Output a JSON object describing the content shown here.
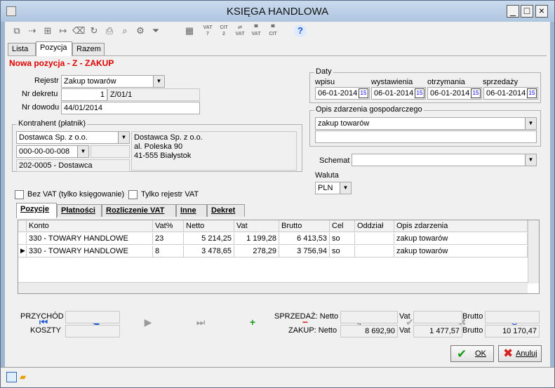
{
  "window": {
    "title": "KSIĘGA HANDLOWA",
    "minimize": "_",
    "maximize": "□",
    "close": "×"
  },
  "toolbar": {
    "icons": [
      "copy-icon",
      "insert-icon",
      "duplicate-icon",
      "move-icon",
      "delete-icon",
      "refresh-icon",
      "print-icon",
      "search-icon",
      "tools-icon",
      "filter-icon"
    ],
    "vat_labels": [
      "VAT\n?",
      "CIT\n?",
      "VAT",
      "VAT",
      "CIT"
    ],
    "help": "?"
  },
  "tabs": [
    {
      "label": "Lista"
    },
    {
      "label": "Pozycja"
    },
    {
      "label": "Razem"
    }
  ],
  "form": {
    "title": "Nowa pozycja - Z - ZAKUP",
    "rejestr_label": "Rejestr",
    "rejestr_value": "Zakup towarów",
    "nr_dekretu_label": "Nr dekretu",
    "nr_dekretu_num": "1",
    "nr_dekretu_value": "Z/01/1",
    "nr_dowodu_label": "Nr dowodu",
    "nr_dowodu_value": "44/01/2014",
    "daty_label": "Daty",
    "dates": [
      {
        "label": "wpisu",
        "value": "06-01-2014"
      },
      {
        "label": "wystawienia",
        "value": "06-01-2014"
      },
      {
        "label": "otrzymania",
        "value": "06-01-2014"
      },
      {
        "label": "sprzedaży",
        "value": "06-01-2014"
      }
    ],
    "calendar_glyph": "15",
    "opis_label": "Opis zdarzenia gospodarczego",
    "opis_value": "zakup towarów",
    "kontrahent_label": "Kontrahent (płatnik)",
    "kontrahent_name": "Dostawca Sp. z o.o.",
    "kontrahent_nip": "000-00-00-008",
    "kontrahent_code": "202-0005 - Dostawca",
    "address_line1": "Dostawca Sp. z o.o.",
    "address_line2": "al. Poleska 90",
    "address_line3": "41-555 Białystok",
    "schemat_label": "Schemat",
    "schemat_value": "",
    "waluta_label": "Waluta",
    "waluta_value": "PLN",
    "bez_vat_label": "Bez VAT (tylko księgowanie)",
    "tylko_rejestr_label": "Tylko rejestr VAT"
  },
  "subtabs": [
    {
      "label": "Pozycje"
    },
    {
      "label": "Płatności"
    },
    {
      "label": "Rozliczenie VAT"
    },
    {
      "label": "Inne"
    },
    {
      "label": "Dekret"
    }
  ],
  "grid": {
    "columns": [
      "Konto",
      "Vat%",
      "Netto",
      "Vat",
      "Brutto",
      "Cel",
      "Oddział",
      "Opis zdarzenia"
    ],
    "rows": [
      [
        "330 - TOWARY HANDLOWE",
        "23",
        "5 214,25",
        "1 199,28",
        "6 413,53",
        "so",
        "",
        "zakup towarów"
      ],
      [
        "330 - TOWARY HANDLOWE",
        "8",
        "3 478,65",
        "278,29",
        "3 756,94",
        "so",
        "",
        "zakup towarów"
      ]
    ]
  },
  "totals": {
    "przychod_label": "PRZYCHÓD",
    "koszty_label": "KOSZTY",
    "sprzedaz_label": "SPRZEDAŻ: Netto",
    "zakup_label": "ZAKUP: Netto",
    "vat_label": "Vat",
    "brutto_label": "Brutto",
    "zakup_netto": "8 692,90",
    "zakup_vat": "1 477,57",
    "zakup_brutto": "10 170,47"
  },
  "buttons": {
    "ok": "OK",
    "cancel": "Anuluj"
  },
  "colors": {
    "accent": "#e00000",
    "nav": "#1e5ad8",
    "add": "#1b9a1b",
    "remove": "#d82020"
  }
}
